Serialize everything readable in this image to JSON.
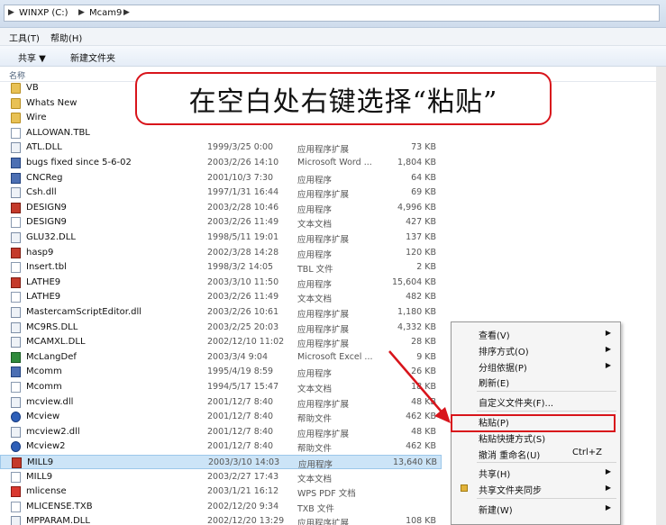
{
  "address": {
    "crumbs": [
      "WINXP (C:)",
      "Mcam9"
    ]
  },
  "menubar": {
    "tools": "工具(T)",
    "help": "帮助(H)"
  },
  "toolbar": {
    "share": "共享 ▼",
    "new_folder": "新建文件夹"
  },
  "columns": {
    "name": "名称"
  },
  "callout": {
    "text": "在空白处右键选择“粘贴”"
  },
  "files": [
    {
      "name": "VB",
      "date": "",
      "type": "",
      "size": "",
      "icon": "folder-icon"
    },
    {
      "name": "Whats New",
      "date": "",
      "type": "",
      "size": "",
      "icon": "folder-icon"
    },
    {
      "name": "Wire",
      "date": "",
      "type": "",
      "size": "",
      "icon": "folder-icon"
    },
    {
      "name": "ALLOWAN.TBL",
      "date": "",
      "type": "",
      "size": "",
      "icon": "file-icon"
    },
    {
      "name": "ATL.DLL",
      "date": "1999/3/25 0:00",
      "type": "应用程序扩展",
      "size": "73 KB",
      "icon": "dll-icon"
    },
    {
      "name": "bugs fixed since 5-6-02",
      "date": "2003/2/26 14:10",
      "type": "Microsoft Word ...",
      "size": "1,804 KB",
      "icon": "app-icon"
    },
    {
      "name": "CNCReg",
      "date": "2001/10/3 7:30",
      "type": "应用程序",
      "size": "64 KB",
      "icon": "app-icon"
    },
    {
      "name": "Csh.dll",
      "date": "1997/1/31 16:44",
      "type": "应用程序扩展",
      "size": "69 KB",
      "icon": "dll-icon"
    },
    {
      "name": "DESIGN9",
      "date": "2003/2/28 10:46",
      "type": "应用程序",
      "size": "4,996 KB",
      "icon": "red-app-icon"
    },
    {
      "name": "DESIGN9",
      "date": "2003/2/26 11:49",
      "type": "文本文档",
      "size": "427 KB",
      "icon": "text-file-icon"
    },
    {
      "name": "GLU32.DLL",
      "date": "1998/5/11 19:01",
      "type": "应用程序扩展",
      "size": "137 KB",
      "icon": "dll-icon"
    },
    {
      "name": "hasp9",
      "date": "2002/3/28 14:28",
      "type": "应用程序",
      "size": "120 KB",
      "icon": "red-app-icon"
    },
    {
      "name": "Insert.tbl",
      "date": "1998/3/2 14:05",
      "type": "TBL 文件",
      "size": "2 KB",
      "icon": "file-icon"
    },
    {
      "name": "LATHE9",
      "date": "2003/3/10 11:50",
      "type": "应用程序",
      "size": "15,604 KB",
      "icon": "red-app-icon"
    },
    {
      "name": "LATHE9",
      "date": "2003/2/26 11:49",
      "type": "文本文档",
      "size": "482 KB",
      "icon": "text-file-icon"
    },
    {
      "name": "MastercamScriptEditor.dll",
      "date": "2003/2/26 10:61",
      "type": "应用程序扩展",
      "size": "1,180 KB",
      "icon": "dll-icon"
    },
    {
      "name": "MC9RS.DLL",
      "date": "2003/2/25 20:03",
      "type": "应用程序扩展",
      "size": "4,332 KB",
      "icon": "dll-icon"
    },
    {
      "name": "MCAMXL.DLL",
      "date": "2002/12/10 11:02",
      "type": "应用程序扩展",
      "size": "28 KB",
      "icon": "dll-icon"
    },
    {
      "name": "McLangDef",
      "date": "2003/3/4 9:04",
      "type": "Microsoft Excel ...",
      "size": "9 KB",
      "icon": "excel-icon"
    },
    {
      "name": "Mcomm",
      "date": "1995/4/19 8:59",
      "type": "应用程序",
      "size": "26 KB",
      "icon": "app-icon"
    },
    {
      "name": "Mcomm",
      "date": "1994/5/17 15:47",
      "type": "文本文档",
      "size": "18 KB",
      "icon": "text-file-icon"
    },
    {
      "name": "mcview.dll",
      "date": "2001/12/7 8:40",
      "type": "应用程序扩展",
      "size": "48 KB",
      "icon": "dll-icon"
    },
    {
      "name": "Mcview",
      "date": "2001/12/7 8:40",
      "type": "帮助文件",
      "size": "462 KB",
      "icon": "help-icon"
    },
    {
      "name": "mcview2.dll",
      "date": "2001/12/7 8:40",
      "type": "应用程序扩展",
      "size": "48 KB",
      "icon": "dll-icon"
    },
    {
      "name": "Mcview2",
      "date": "2001/12/7 8:40",
      "type": "帮助文件",
      "size": "462 KB",
      "icon": "help-icon"
    },
    {
      "name": "MILL9",
      "date": "2003/3/10 14:03",
      "type": "应用程序",
      "size": "13,640 KB",
      "icon": "red-app-icon",
      "selected": true
    },
    {
      "name": "MILL9",
      "date": "2003/2/27 17:43",
      "type": "文本文档",
      "size": "",
      "icon": "text-file-icon"
    },
    {
      "name": "mlicense",
      "date": "2003/1/21 16:12",
      "type": "WPS PDF 文档",
      "size": "",
      "icon": "wps-icon"
    },
    {
      "name": "MLICENSE.TXB",
      "date": "2002/12/20 9:34",
      "type": "TXB 文件",
      "size": "",
      "icon": "file-icon"
    },
    {
      "name": "MPPARAM.DLL",
      "date": "2002/12/20 13:29",
      "type": "应用程序扩展",
      "size": "108 KB",
      "icon": "dll-icon"
    }
  ],
  "context_menu": {
    "items": [
      {
        "label": "查看(V)",
        "arrow": "▶",
        "shortcut": ""
      },
      {
        "label": "排序方式(O)",
        "arrow": "▶",
        "shortcut": ""
      },
      {
        "label": "分组依据(P)",
        "arrow": "▶",
        "shortcut": ""
      },
      {
        "label": "刷新(E)",
        "arrow": "",
        "shortcut": ""
      },
      {
        "sep": true
      },
      {
        "label": "自定义文件夹(F)...",
        "arrow": "",
        "shortcut": ""
      },
      {
        "sep": true
      },
      {
        "label": "粘贴(P)",
        "arrow": "",
        "shortcut": "",
        "highlight": true
      },
      {
        "label": "粘贴快捷方式(S)",
        "arrow": "",
        "shortcut": ""
      },
      {
        "label": "撤消 重命名(U)",
        "arrow": "",
        "shortcut": "Ctrl+Z"
      },
      {
        "sep": true
      },
      {
        "label": "共享(H)",
        "arrow": "▶",
        "shortcut": ""
      },
      {
        "label": "共享文件夹同步",
        "arrow": "▶",
        "shortcut": "",
        "icon": true
      },
      {
        "sep": true
      },
      {
        "label": "新建(W)",
        "arrow": "▶",
        "shortcut": ""
      }
    ]
  },
  "colors": {
    "callout_border": "#d8141b",
    "selection": "#cce4f7",
    "arrow": "#d8141b"
  }
}
